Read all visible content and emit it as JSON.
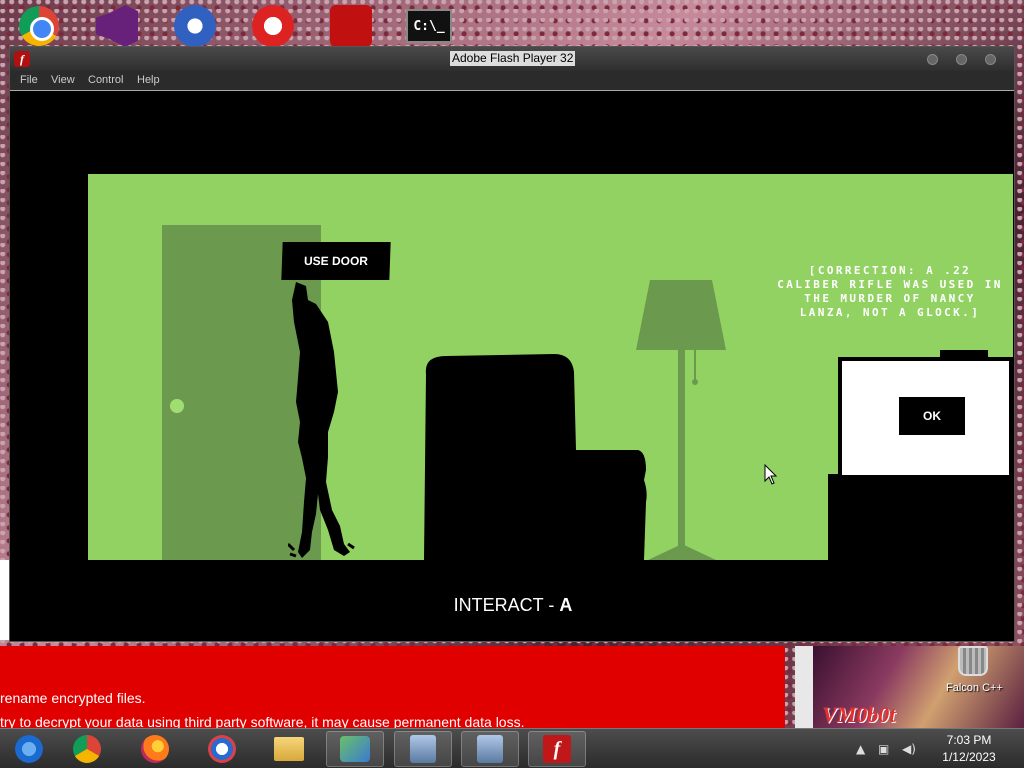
{
  "desktop": {
    "icons": [
      "chrome-icon",
      "visual-studio-icon",
      "vpn-icon",
      "red-app-icon",
      "red-shield-icon",
      "command-prompt-icon"
    ],
    "cmd_label": "C:\\_",
    "ransom_lines": [
      "rename encrypted files.",
      "try to decrypt your data using third party software, it may cause permanent data loss."
    ],
    "falcon_label": "Falcon C++",
    "vm_logo": "VM0b0t"
  },
  "window": {
    "title": "Adobe Flash Player 32",
    "menu": [
      "File",
      "View",
      "Control",
      "Help"
    ]
  },
  "game": {
    "use_door_label": "USE DOOR",
    "correction_text": "[CORRECTION: A .22 CALIBER RIFLE WAS USED IN THE MURDER OF NANCY LANZA, NOT A GLOCK.]",
    "ok_label": "OK",
    "interact_prefix": "INTERACT - ",
    "interact_key": "A",
    "colors": {
      "wall": "#92d262",
      "door": "#6b9a4e",
      "silhouette": "#000000"
    }
  },
  "taskbar": {
    "apps": [
      "start-button",
      "chrome",
      "firefox",
      "obama-app",
      "file-explorer",
      "network-app",
      "installer-1",
      "installer-2",
      "flash-player"
    ],
    "clock_time": "7:03 PM",
    "clock_date": "1/12/2023"
  }
}
